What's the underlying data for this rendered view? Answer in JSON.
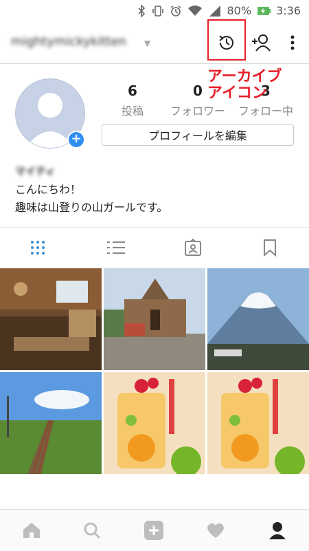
{
  "status_bar": {
    "battery": "80%",
    "time": "3:36"
  },
  "header": {
    "username": "mightymickykitten",
    "icons": [
      "archive-icon",
      "add-user-icon",
      "more-icon"
    ]
  },
  "annotation": {
    "line1": "アーカイブ",
    "line2": "アイコン"
  },
  "profile": {
    "posts_count": "6",
    "posts_label": "投稿",
    "followers_count": "0",
    "followers_label": "フォロワー",
    "following_count": "3",
    "following_label": "フォロー中",
    "edit_button": "プロフィールを編集",
    "name": "マイティ",
    "bio_line1": "こんにちわ！",
    "bio_line2": "趣味は山登りの山ガールです。"
  },
  "tabs": [
    "grid-icon",
    "list-icon",
    "tagged-icon",
    "saved-icon"
  ],
  "grid": [
    "cabin-interior",
    "church-building",
    "mount-fuji",
    "railway-track",
    "fruit-drinks",
    "fruit-drinks"
  ],
  "bottom_nav": [
    "home-icon",
    "search-icon",
    "add-icon",
    "heart-icon",
    "profile-icon"
  ],
  "colors": {
    "accent": "#2e8ef2",
    "annotation": "#e8202a"
  }
}
